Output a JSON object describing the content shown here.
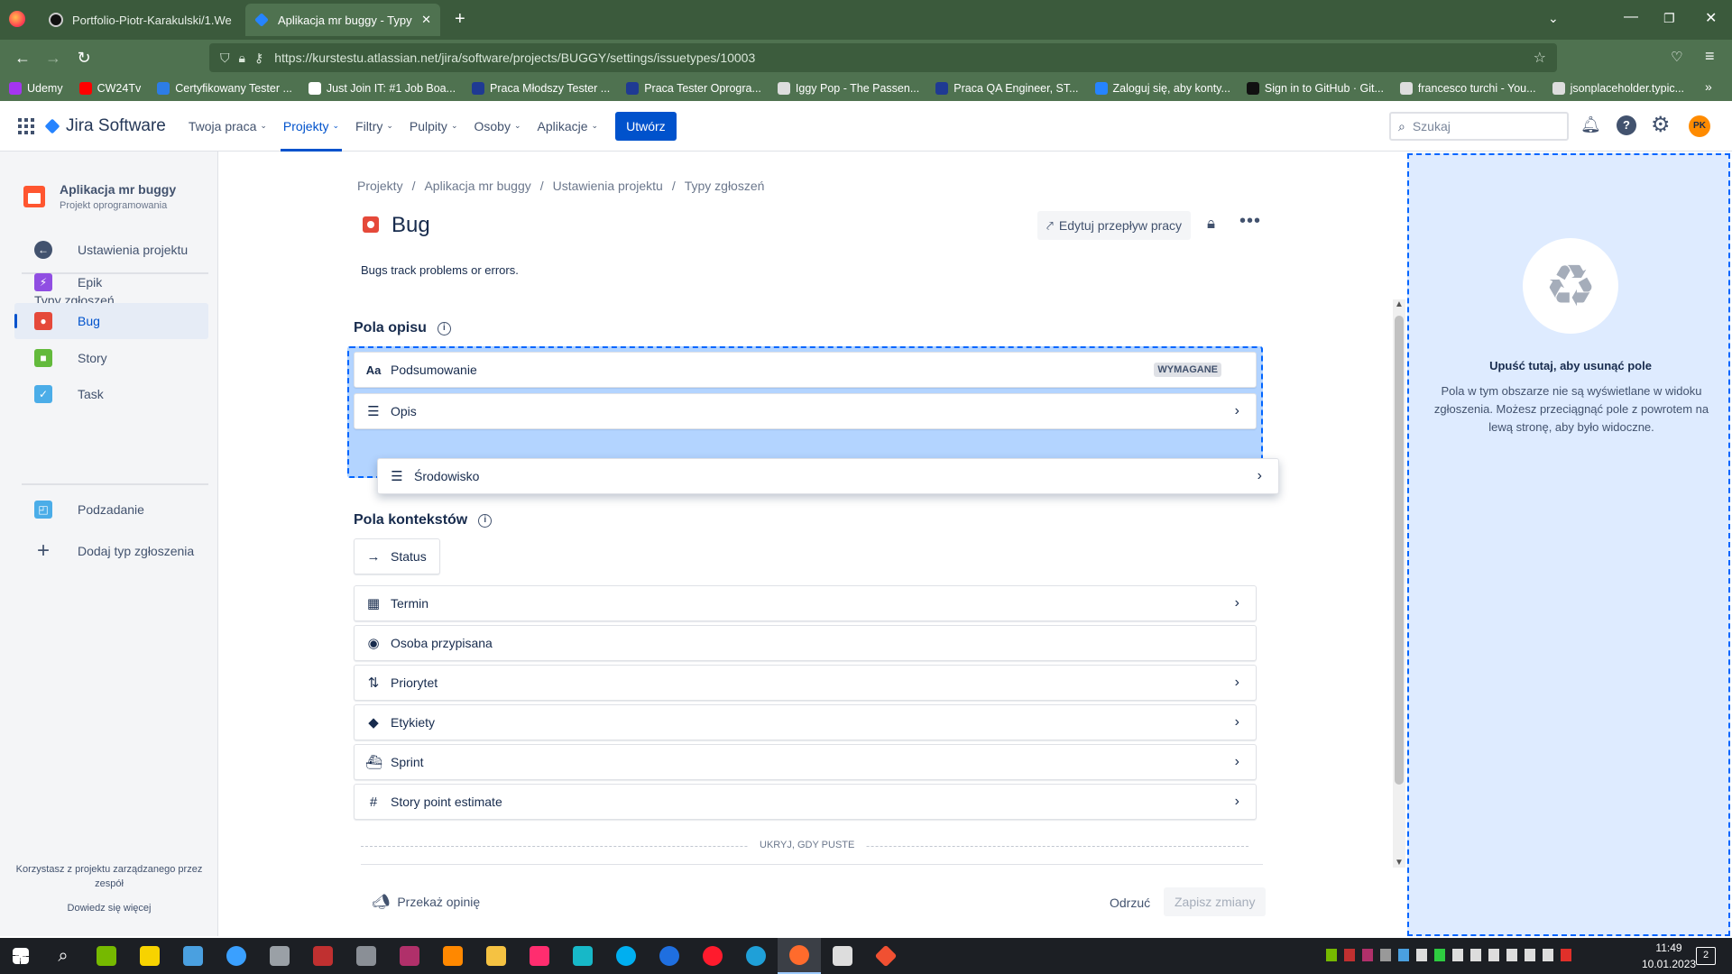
{
  "browser": {
    "tabs": [
      {
        "label": "Portfolio-Piotr-Karakulski/1.We"
      },
      {
        "label": "Aplikacja mr buggy - Typy zgło"
      }
    ],
    "url": "https://kurstestu.atlassian.net/jira/software/projects/BUGGY/settings/issuetypes/10003",
    "bookmarks": [
      {
        "label": "Udemy",
        "color": "#a435f0"
      },
      {
        "label": "CW24Tv",
        "color": "#ff0000"
      },
      {
        "label": "Certyfikowany Tester ...",
        "color": "#2d7de6"
      },
      {
        "label": "Just Join IT: #1 Job Boa...",
        "color": "#ffffff"
      },
      {
        "label": "Praca Młodszy Tester ...",
        "color": "#1f3a93"
      },
      {
        "label": "Praca Tester Oprogra...",
        "color": "#1f3a93"
      },
      {
        "label": "Iggy Pop - The Passen...",
        "color": "#dddddd"
      },
      {
        "label": "Praca QA Engineer, ST...",
        "color": "#1f3a93"
      },
      {
        "label": "Zaloguj się, aby konty...",
        "color": "#2684ff"
      },
      {
        "label": "Sign in to GitHub · Git...",
        "color": "#111111"
      },
      {
        "label": "francesco turchi - You...",
        "color": "#dddddd"
      },
      {
        "label": "jsonplaceholder.typic...",
        "color": "#dddddd"
      }
    ]
  },
  "jira": {
    "logo": "Jira Software",
    "nav": [
      "Twoja praca",
      "Projekty",
      "Filtry",
      "Pulpity",
      "Osoby",
      "Aplikacje"
    ],
    "create": "Utwórz",
    "search_placeholder": "Szukaj",
    "avatar": "PK"
  },
  "sidebar": {
    "project_name": "Aplikacja mr buggy",
    "project_type": "Projekt oprogramowania",
    "back": "Ustawienia projektu",
    "section": "Typy zgłoszeń",
    "items": [
      {
        "label": "Epik",
        "color": "#904ee2",
        "glyph": "⚡"
      },
      {
        "label": "Bug",
        "color": "#e5493a",
        "glyph": "●"
      },
      {
        "label": "Story",
        "color": "#63ba3c",
        "glyph": "■"
      },
      {
        "label": "Task",
        "color": "#4bade8",
        "glyph": "✓"
      }
    ],
    "subtask": "Podzadanie",
    "add": "Dodaj typ zgłoszenia",
    "footer": "Korzystasz z projektu zarządzanego przez zespół",
    "learn_more": "Dowiedz się więcej"
  },
  "main": {
    "breadcrumbs": [
      "Projekty",
      "Aplikacja mr buggy",
      "Ustawienia projektu",
      "Typy zgłoszeń"
    ],
    "title": "Bug",
    "edit_workflow": "Edytuj przepływ pracy",
    "description": "Bugs track problems or errors.",
    "desc_section": "Pola opisu",
    "desc_fields": [
      {
        "label": "Podsumowanie",
        "badge": "WYMAGANE"
      },
      {
        "label": "Opis"
      }
    ],
    "dragged_field": "Środowisko",
    "ctx_section": "Pola kontekstów",
    "status": "Status",
    "ctx_fields": [
      {
        "label": "Termin",
        "icon": "calendar-icon",
        "glyph": "▦",
        "chevron": true
      },
      {
        "label": "Osoba przypisana",
        "icon": "person-icon",
        "glyph": "◉",
        "chevron": false
      },
      {
        "label": "Priorytet",
        "icon": "priority-icon",
        "glyph": "⇅",
        "chevron": true
      },
      {
        "label": "Etykiety",
        "icon": "tag-icon",
        "glyph": "◆",
        "chevron": true
      },
      {
        "label": "Sprint",
        "icon": "sprint-icon",
        "glyph": "⛴",
        "chevron": true
      },
      {
        "label": "Story point estimate",
        "icon": "number-icon",
        "glyph": "#",
        "chevron": true
      }
    ],
    "hide_label": "UKRYJ, GDY PUSTE",
    "feedback": "Przekaż opinię",
    "discard": "Odrzuć",
    "save": "Zapisz zmiany"
  },
  "dropzone": {
    "title": "Upuść tutaj, aby usunąć pole",
    "text": "Pola w tym obszarze nie są wyświetlane w widoku zgłoszenia. Możesz przeciągnąć pole z powrotem na lewą stronę, aby było widoczne."
  },
  "system": {
    "time": "11:49",
    "date": "10.01.2023",
    "notifications": "2"
  }
}
